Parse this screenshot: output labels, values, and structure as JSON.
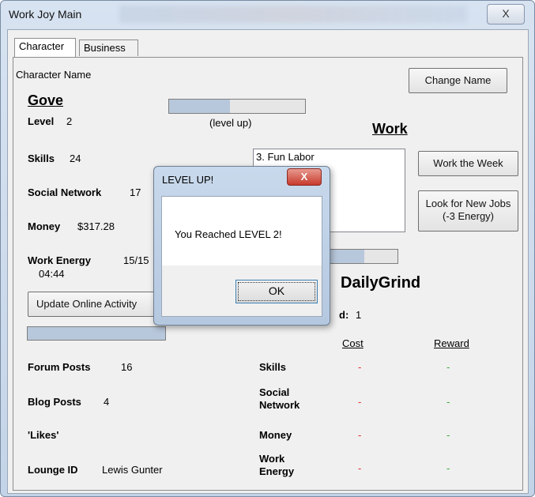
{
  "window": {
    "title": "Work Joy Main",
    "close_glyph": "X"
  },
  "tabs": [
    {
      "label": "Character"
    },
    {
      "label": "Business"
    }
  ],
  "character": {
    "name_label": "Character Name",
    "change_name_button": "Change Name",
    "name": "Gove",
    "level_label": "Level",
    "level_value": "2",
    "level_progress": 0.45,
    "level_up_text": "(level up)",
    "skills_label": "Skills",
    "skills_value": "24",
    "social_label": "Social Network",
    "social_value": "17",
    "money_label": "Money",
    "money_value": "$317.28",
    "energy_label": "Work Energy",
    "energy_value": "15/15",
    "energy_time": "04:44",
    "update_button": "Update Online Activity",
    "update_progress": 1.0,
    "forum_label": "Forum Posts",
    "forum_value": "16",
    "blog_label": "Blog Posts",
    "blog_value": "4",
    "likes_label": "'Likes'",
    "lounge_label": "Lounge ID",
    "lounge_value": "Lewis Gunter"
  },
  "work": {
    "heading": "Work",
    "job_list": [
      "3. Fun Labor"
    ],
    "work_week_button": "Work the Week",
    "look_jobs_button_line1": "Look for New Jobs",
    "look_jobs_button_line2": "(-3 Energy)",
    "job_progress": 0.5,
    "job_title_partial": "DailyGrind",
    "completed_partial": "d:",
    "completed_value": "1",
    "cost_header": "Cost",
    "reward_header": "Reward",
    "rows": [
      {
        "label": "Skills",
        "cost": "-",
        "reward": "-"
      },
      {
        "label": "Social Network",
        "cost": "-",
        "reward": "-"
      },
      {
        "label": "Money",
        "cost": "-",
        "reward": "-"
      },
      {
        "label": "Work Energy",
        "cost": "-",
        "reward": "-"
      }
    ]
  },
  "dialog": {
    "title": "LEVEL UP!",
    "close_glyph": "X",
    "message": "You Reached LEVEL 2!",
    "ok_button": "OK"
  },
  "colors": {
    "progress_fill": "#b8c8dc",
    "cost_dash": "#e23030",
    "reward_dash": "#33a833"
  }
}
